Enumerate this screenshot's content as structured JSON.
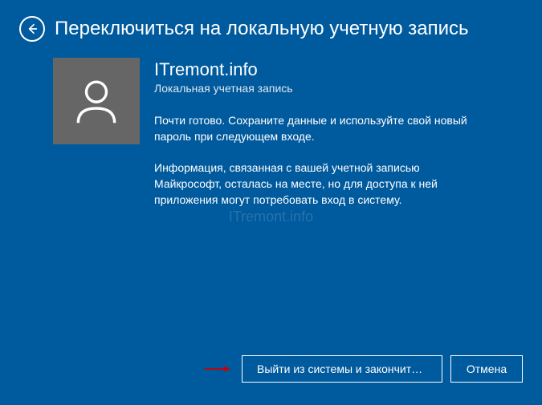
{
  "header": {
    "title": "Переключиться на локальную учетную запись"
  },
  "account": {
    "username": "ITremont.info",
    "type": "Локальная учетная запись"
  },
  "messages": {
    "line1": "Почти готово. Сохраните данные и используйте свой новый пароль при следующем входе.",
    "line2": "Информация, связанная с вашей учетной записью Майкрософт, осталась на месте, но для доступа к ней приложения могут потребовать вход в систему."
  },
  "watermark": "ITremont.info",
  "buttons": {
    "primary": "Выйти из системы и закончить р…",
    "cancel": "Отмена"
  }
}
